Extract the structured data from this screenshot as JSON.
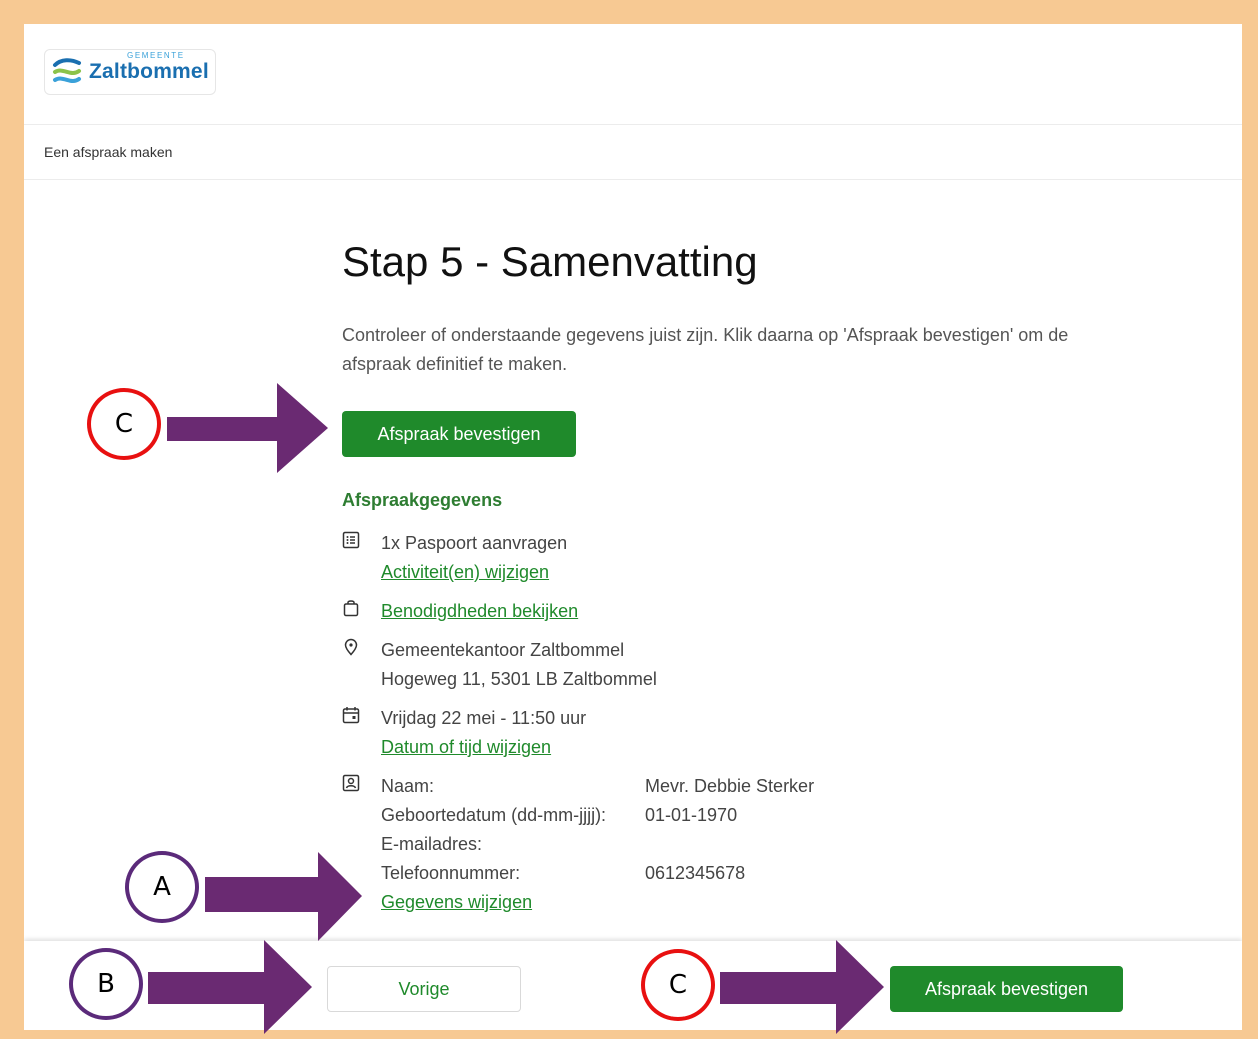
{
  "header": {
    "logo_small": "GEMEENTE",
    "logo_name": "Zaltbommel"
  },
  "breadcrumb": "Een afspraak maken",
  "page": {
    "title": "Stap 5 - Samenvatting",
    "intro": "Controleer of onderstaande gegevens juist zijn. Klik daarna op 'Afspraak bevestigen' om de afspraak definitief te maken.",
    "confirm_label": "Afspraak bevestigen"
  },
  "details": {
    "section_title": "Afspraakgegevens",
    "activity": "1x Paspoort aanvragen",
    "activity_link": "Activiteit(en) wijzigen",
    "requirements_link": "Benodigdheden bekijken",
    "location_name": "Gemeentekantoor Zaltbommel",
    "location_address": "Hogeweg 11, 5301 LB Zaltbommel",
    "datetime": "Vrijdag 22 mei - 11:50 uur",
    "datetime_link": "Datum of tijd wijzigen",
    "person": {
      "name_label": "Naam:",
      "name_value": "Mevr. Debbie Sterker",
      "dob_label": "Geboortedatum (dd-mm-jjjj):",
      "dob_value": "01-01-1970",
      "email_label": "E-mailadres:",
      "email_value": "",
      "phone_label": "Telefoonnummer:",
      "phone_value": "0612345678"
    },
    "person_link": "Gegevens wijzigen"
  },
  "footer": {
    "prev_label": "Vorige",
    "confirm_label": "Afspraak bevestigen"
  },
  "annotations": {
    "label_c_top": "C",
    "label_a": "A",
    "label_b": "B",
    "label_c_bottom": "C"
  },
  "colors": {
    "brand_green": "#1f8a2b",
    "frame": "#f7c993",
    "arrow": "#6a2a72",
    "circle_red": "#e81010",
    "circle_purple": "#5b2a7a"
  }
}
